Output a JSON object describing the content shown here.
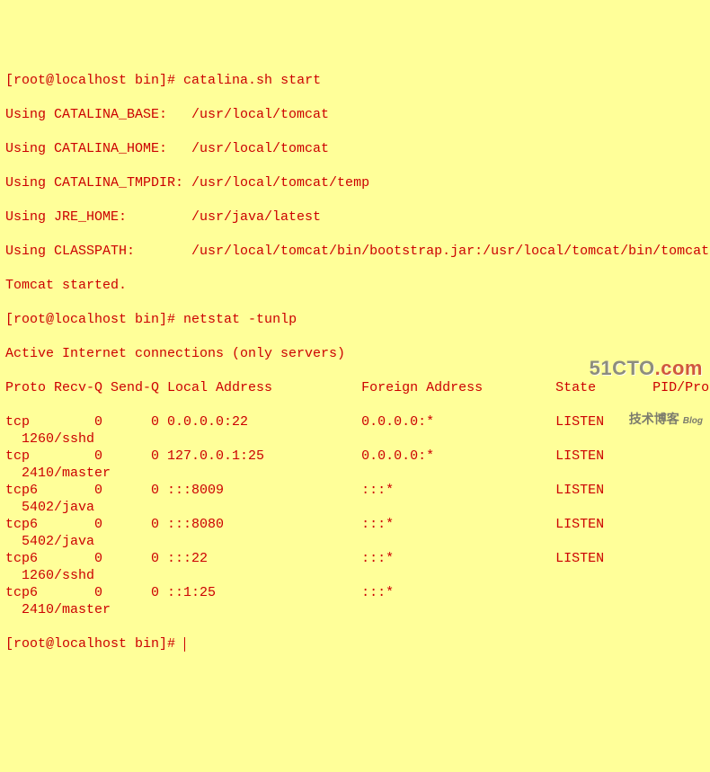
{
  "prompt1": "[root@localhost bin]# ",
  "cmd1": "catalina.sh start",
  "env": {
    "base": "Using CATALINA_BASE:   /usr/local/tomcat",
    "home": "Using CATALINA_HOME:   /usr/local/tomcat",
    "tmpdir": "Using CATALINA_TMPDIR: /usr/local/tomcat/temp",
    "jre": "Using JRE_HOME:        /usr/java/latest",
    "cp": "Using CLASSPATH:       /usr/local/tomcat/bin/bootstrap.jar:/usr/local/tomcat/bin/tomcat-juli.jar"
  },
  "started": "Tomcat started.",
  "prompt2": "[root@localhost bin]# ",
  "cmd2": "netstat -tunlp",
  "nheader1": "Active Internet connections (only servers)",
  "nheader2": "Proto Recv-Q Send-Q Local Address           Foreign Address         State       PID/Program name",
  "rows": [
    {
      "proto": "tcp ",
      "recvq": "0",
      "sendq": "0",
      "local": "0.0.0.0:22   ",
      "foreign": "0.0.0.0:*",
      "state": "LISTEN",
      "pid": "1260/sshd"
    },
    {
      "proto": "tcp ",
      "recvq": "0",
      "sendq": "0",
      "local": "127.0.0.1:25 ",
      "foreign": "0.0.0.0:*",
      "state": "LISTEN",
      "pid": "2410/master"
    },
    {
      "proto": "tcp6",
      "recvq": "0",
      "sendq": "0",
      "local": ":::8009      ",
      "foreign": ":::*     ",
      "state": "LISTEN",
      "pid": "5402/java"
    },
    {
      "proto": "tcp6",
      "recvq": "0",
      "sendq": "0",
      "local": ":::8080      ",
      "foreign": ":::*     ",
      "state": "LISTEN",
      "pid": "5402/java"
    },
    {
      "proto": "tcp6",
      "recvq": "0",
      "sendq": "0",
      "local": ":::22        ",
      "foreign": ":::*     ",
      "state": "LISTEN",
      "pid": "1260/sshd"
    },
    {
      "proto": "tcp6",
      "recvq": "0",
      "sendq": "0",
      "local": "::1:25       ",
      "foreign": ":::*     ",
      "state": "      ",
      "pid": "2410/master"
    }
  ],
  "prompt3": "[root@localhost bin]# ",
  "watermark": {
    "top1": "51CTO",
    "top2": ".com",
    "bottom": "技术博客",
    "blog": "Blog"
  }
}
